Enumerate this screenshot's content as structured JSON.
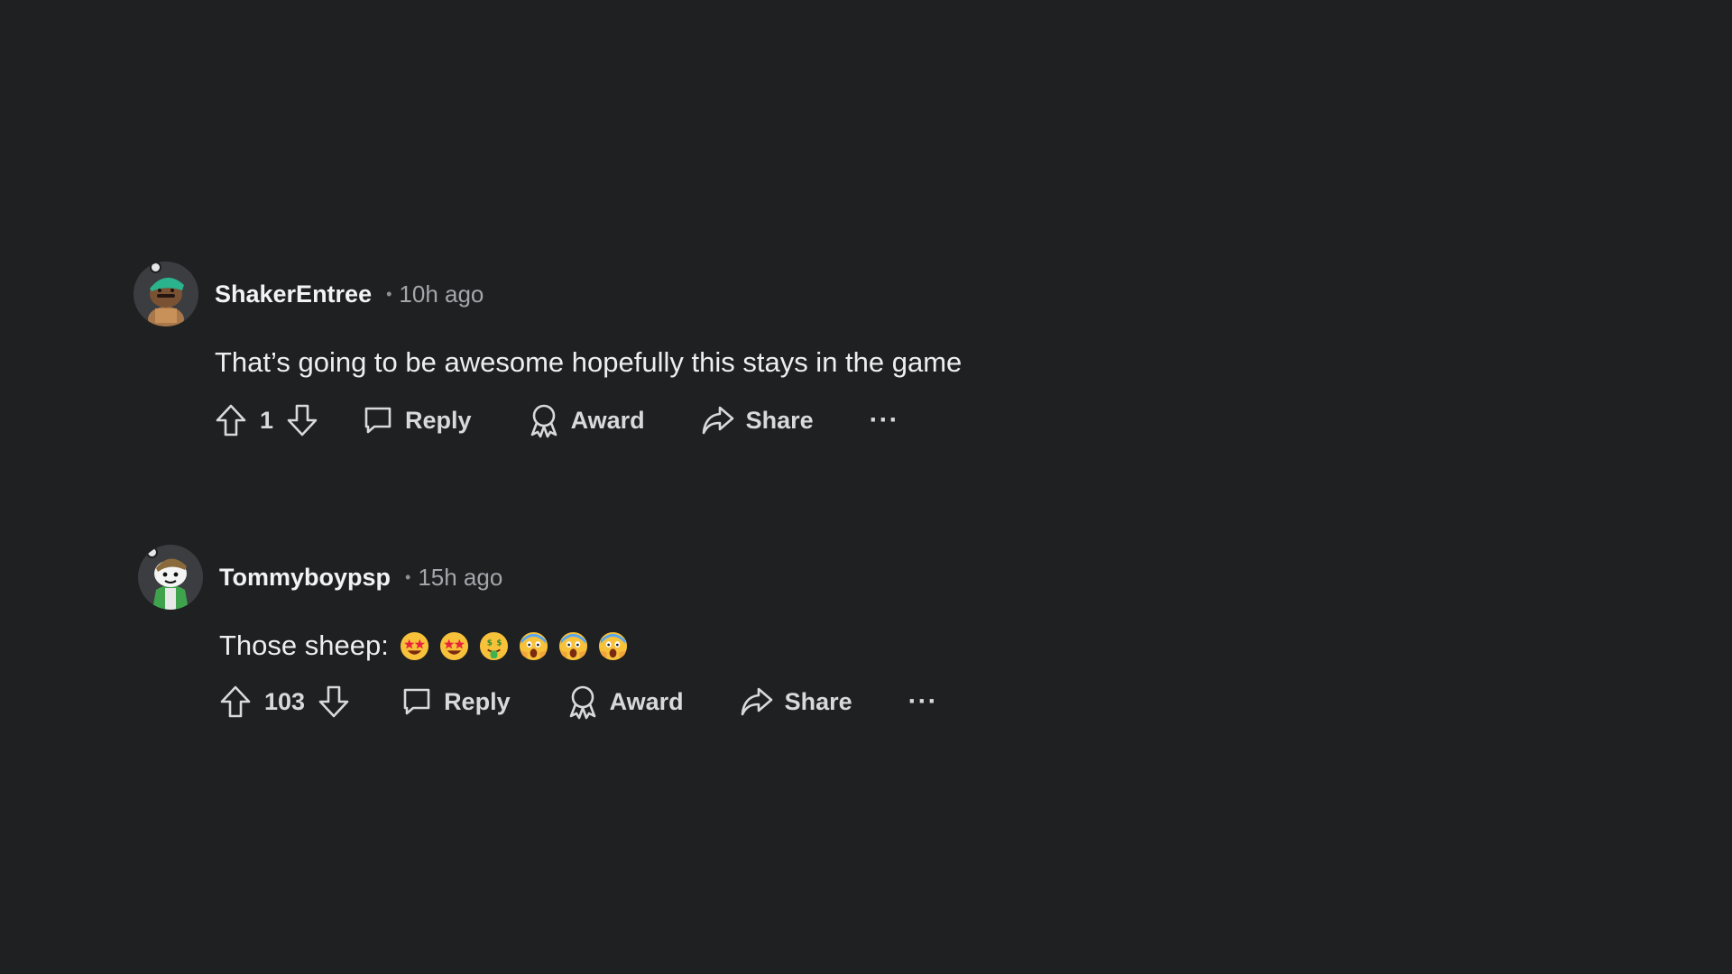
{
  "comments": [
    {
      "username": "ShakerEntree",
      "separator": "•",
      "time": "10h ago",
      "text": "That’s going to be awesome hopefully this stays in the game",
      "emojis": [],
      "votes": "1",
      "reply_label": "Reply",
      "award_label": "Award",
      "share_label": "Share",
      "more_label": "···"
    },
    {
      "username": "Tommyboypsp",
      "separator": "•",
      "time": "15h ago",
      "text": "Those sheep:",
      "emojis": [
        "star-struck",
        "star-struck",
        "money-mouth",
        "screaming",
        "screaming",
        "screaming"
      ],
      "votes": "103",
      "reply_label": "Reply",
      "award_label": "Award",
      "share_label": "Share",
      "more_label": "···"
    }
  ],
  "colors": {
    "background": "#1f2022",
    "text": "#eceef0",
    "muted": "#a3a6aa"
  },
  "icons": [
    "upvote-icon",
    "downvote-icon",
    "reply-icon",
    "award-icon",
    "share-icon",
    "more-icon"
  ]
}
